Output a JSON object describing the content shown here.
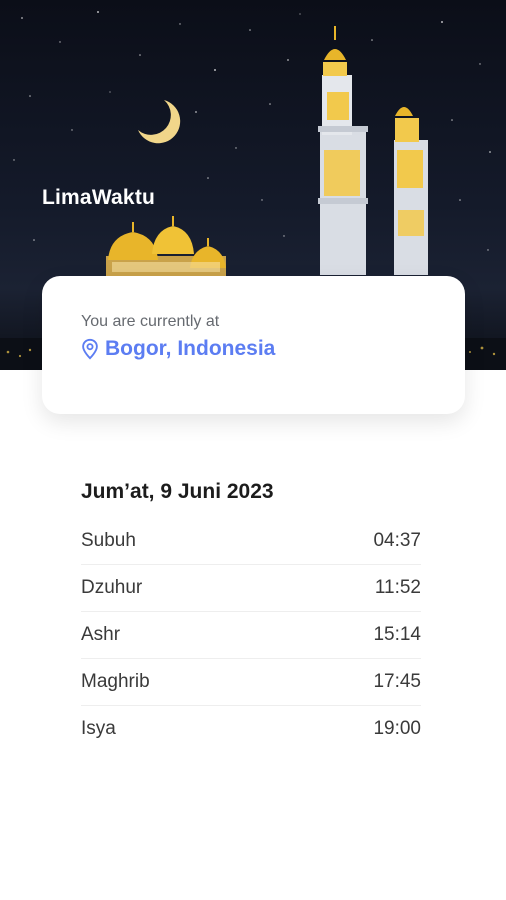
{
  "app": {
    "title": "LimaWaktu"
  },
  "location": {
    "label": "You are currently at",
    "name": "Bogor, Indonesia",
    "icon": "map-pin-icon"
  },
  "schedule": {
    "date": "Jum’at, 9 Juni 2023",
    "times": [
      {
        "name": "Subuh",
        "time": "04:37"
      },
      {
        "name": "Dzuhur",
        "time": "11:52"
      },
      {
        "name": "Ashr",
        "time": "15:14"
      },
      {
        "name": "Maghrib",
        "time": "17:45"
      },
      {
        "name": "Isya",
        "time": "19:00"
      }
    ]
  },
  "colors": {
    "accent": "#5c7df2",
    "sky": "#141a2a",
    "dome": "#e8b52a",
    "tower": "#d9dde4",
    "lamp": "#f2c94c"
  }
}
